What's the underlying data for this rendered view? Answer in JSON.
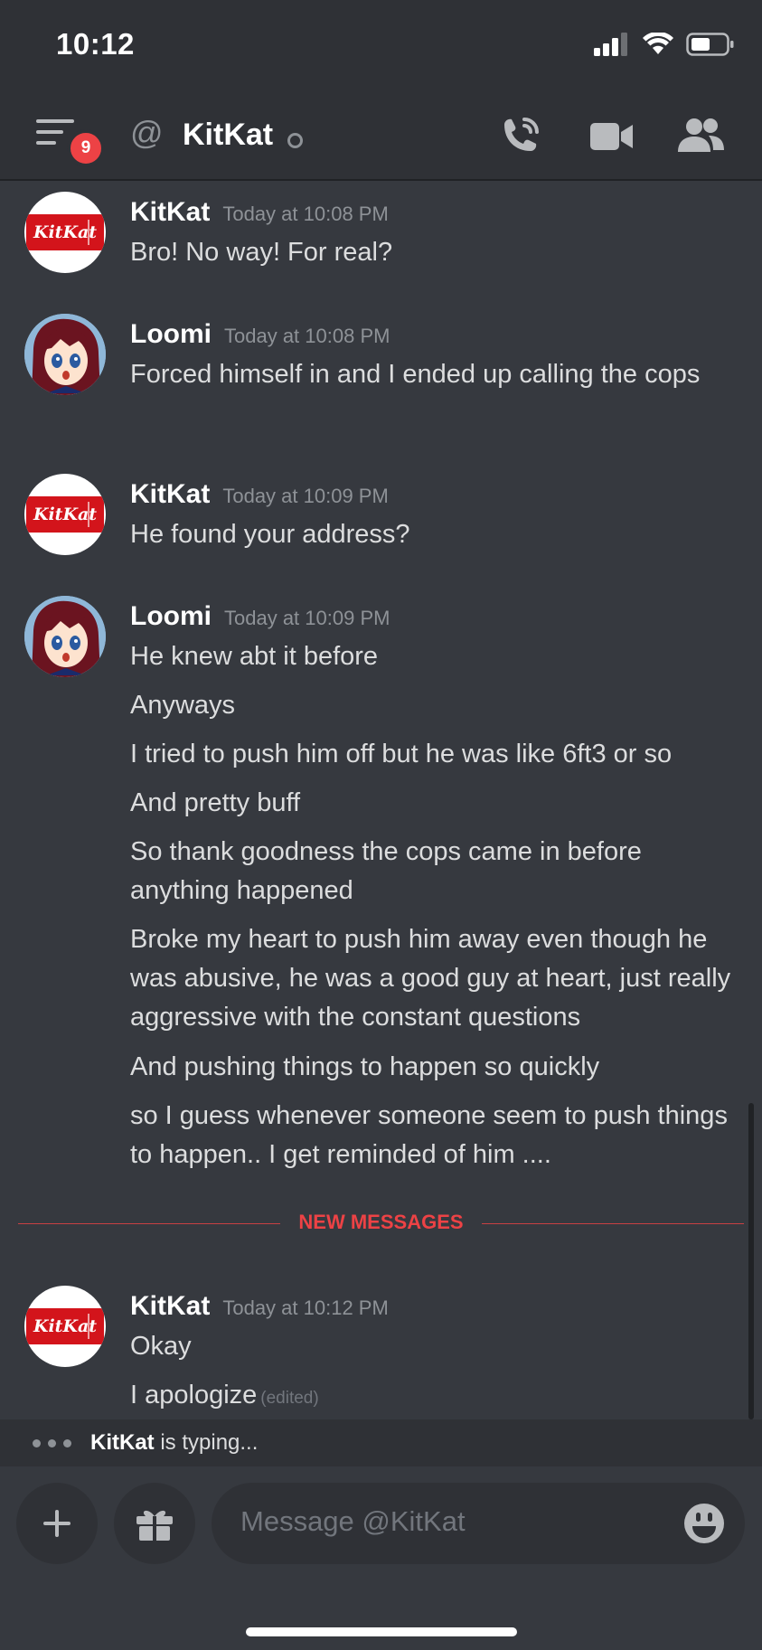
{
  "status_bar": {
    "time": "10:12"
  },
  "header": {
    "badge_count": "9",
    "at_symbol": "@",
    "channel_title": "KitKat"
  },
  "messages": [
    {
      "author": "KitKat",
      "timestamp": "Today at 10:08 PM",
      "lines": [
        "Bro! No way! For real?"
      ]
    },
    {
      "author": "Loomi",
      "timestamp": "Today at 10:08 PM",
      "lines": [
        "Forced himself in and I ended up calling the cops"
      ]
    },
    {
      "author": "KitKat",
      "timestamp": "Today at 10:09 PM",
      "lines": [
        "He found your address?"
      ]
    },
    {
      "author": "Loomi",
      "timestamp": "Today at 10:09 PM",
      "lines": [
        "He knew abt it before",
        "Anyways",
        "I tried to push him off but he was like 6ft3 or so",
        "And pretty buff",
        "So thank goodness the cops came in before anything happened",
        "Broke my heart to push him away even though he was abusive, he was a good guy at heart, just really aggressive with the constant questions",
        "And pushing things to happen so quickly",
        "so I guess whenever someone seem to push things to happen.. I get reminded of him ...."
      ]
    },
    {
      "author": "KitKat",
      "timestamp": "Today at 10:12 PM",
      "lines": [
        "Okay",
        "I apologize"
      ]
    }
  ],
  "kitkat_logo_text": "KitKat",
  "edited_label": "(edited)",
  "new_messages_divider": "NEW MESSAGES",
  "typing": {
    "user": "KitKat",
    "text": " is typing..."
  },
  "composer": {
    "placeholder": "Message @KitKat"
  },
  "icons": [
    "hamburger-menu-icon",
    "call-icon",
    "video-icon",
    "members-icon",
    "plus-icon",
    "gift-icon",
    "emoji-icon",
    "signal-icon",
    "wifi-icon",
    "battery-icon"
  ],
  "colors": {
    "background": "#36393f",
    "header": "#2f3136",
    "accent_red": "#ed4245",
    "muted": "#8e9297"
  }
}
